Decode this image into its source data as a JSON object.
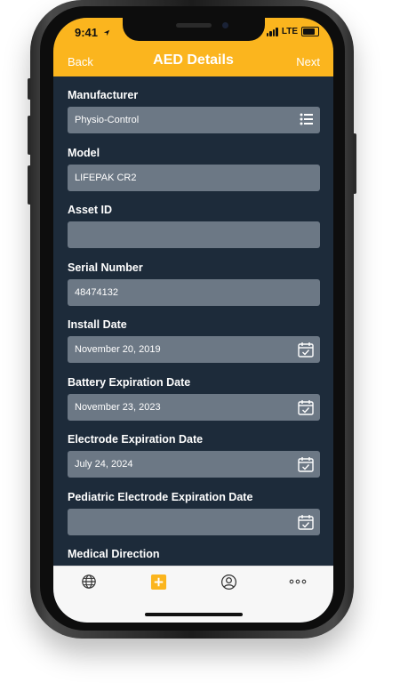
{
  "status_bar": {
    "time": "9:41",
    "network": "LTE"
  },
  "header": {
    "back_label": "Back",
    "title": "AED Details",
    "next_label": "Next"
  },
  "fields": {
    "manufacturer": {
      "label": "Manufacturer",
      "value": "Physio-Control"
    },
    "model": {
      "label": "Model",
      "value": "LIFEPAK CR2"
    },
    "asset_id": {
      "label": "Asset ID",
      "value": ""
    },
    "serial_number": {
      "label": "Serial Number",
      "value": "48474132"
    },
    "install_date": {
      "label": "Install Date",
      "value": "November 20, 2019"
    },
    "battery_expiration": {
      "label": "Battery Expiration Date",
      "value": "November 23, 2023"
    },
    "electrode_expiration": {
      "label": "Electrode Expiration Date",
      "value": "July 24, 2024"
    },
    "pediatric_electrode_expiration": {
      "label": "Pediatric Electrode Expiration Date",
      "value": ""
    },
    "medical_direction": {
      "label": "Medical Direction"
    }
  },
  "tabbar": {
    "items": [
      {
        "icon": "globe-icon"
      },
      {
        "icon": "add-icon"
      },
      {
        "icon": "profile-icon"
      },
      {
        "icon": "more-icon"
      }
    ]
  },
  "colors": {
    "accent": "#fbb51e",
    "background": "#1d2b3a",
    "field": "#6c7885"
  }
}
